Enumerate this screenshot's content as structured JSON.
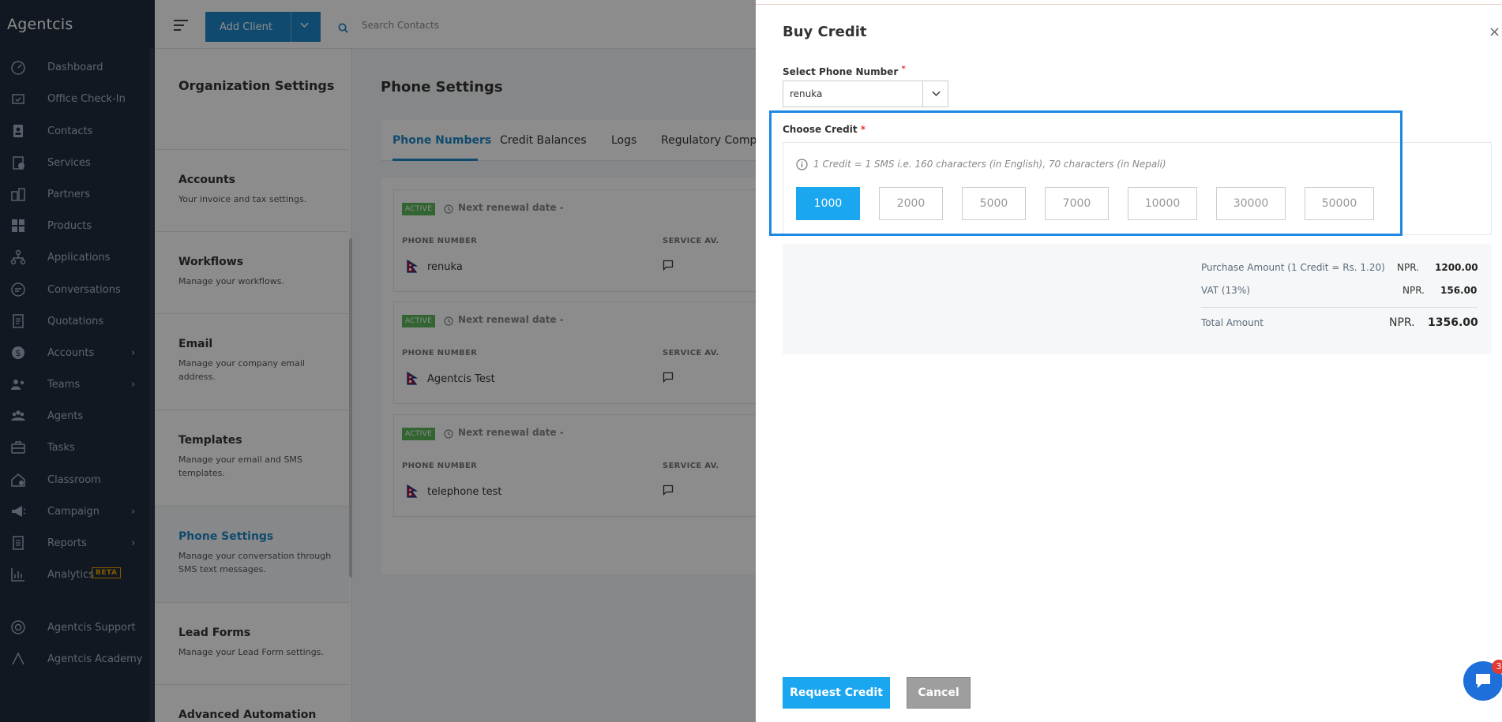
{
  "app": {
    "brand": "Agentcis",
    "nav": [
      {
        "label": "Dashboard",
        "icon": "dashboard-icon"
      },
      {
        "label": "Office Check-In",
        "icon": "check-in-icon"
      },
      {
        "label": "Contacts",
        "icon": "contacts-icon"
      },
      {
        "label": "Services",
        "icon": "services-icon"
      },
      {
        "label": "Partners",
        "icon": "partners-icon"
      },
      {
        "label": "Products",
        "icon": "products-icon"
      },
      {
        "label": "Applications",
        "icon": "applications-icon"
      },
      {
        "label": "Conversations",
        "icon": "conversations-icon"
      },
      {
        "label": "Quotations",
        "icon": "quotations-icon"
      },
      {
        "label": "Accounts",
        "icon": "accounts-icon",
        "chevron": "›"
      },
      {
        "label": "Teams",
        "icon": "teams-icon",
        "chevron": "›"
      },
      {
        "label": "Agents",
        "icon": "agents-icon"
      },
      {
        "label": "Tasks",
        "icon": "tasks-icon"
      },
      {
        "label": "Classroom",
        "icon": "classroom-icon"
      },
      {
        "label": "Campaign",
        "icon": "campaign-icon",
        "chevron": "›"
      },
      {
        "label": "Reports",
        "icon": "reports-icon",
        "chevron": "›"
      },
      {
        "label": "Analytics",
        "icon": "analytics-icon",
        "badge": "BETA"
      },
      {
        "label": "Agentcis Support",
        "icon": "support-icon"
      },
      {
        "label": "Agentcis Academy",
        "icon": "academy-icon"
      }
    ]
  },
  "topbar": {
    "add_client": "Add Client",
    "search_placeholder": "Search Contacts"
  },
  "settings": {
    "title": "Organization Settings",
    "items": [
      {
        "title": "Accounts",
        "desc": "Your invoice and tax settings."
      },
      {
        "title": "Workflows",
        "desc": "Manage your workflows."
      },
      {
        "title": "Email",
        "desc": "Manage your company email address."
      },
      {
        "title": "Templates",
        "desc": "Manage your email and SMS templates."
      },
      {
        "title": "Phone Settings",
        "desc": "Manage your conversation through SMS text messages."
      },
      {
        "title": "Lead Forms",
        "desc": "Manage your Lead Form settings."
      },
      {
        "title": "Advanced Automation",
        "desc": ""
      }
    ]
  },
  "phone": {
    "title": "Phone Settings",
    "tabs": [
      "Phone Numbers",
      "Credit Balances",
      "Logs",
      "Regulatory Compli"
    ],
    "labels": {
      "active": "ACTIVE",
      "renewal": "Next renewal date -",
      "phone_number": "PHONE NUMBER",
      "service": "SERVICE AV."
    },
    "numbers": [
      {
        "name": "renuka"
      },
      {
        "name": "Agentcis Test"
      },
      {
        "name": "telephone test"
      }
    ]
  },
  "drawer": {
    "title": "Buy Credit",
    "close": "×",
    "select_label": "Select Phone Number",
    "select_value": "renuka",
    "choose_label": "Choose Credit",
    "required": "*",
    "info": "1 Credit = 1 SMS i.e. 160 characters (in English), 70 characters (in Nepali)",
    "options": [
      "1000",
      "2000",
      "5000",
      "7000",
      "10000",
      "30000",
      "50000"
    ],
    "selected_option": "1000",
    "summary": {
      "purchase_label": "Purchase Amount",
      "purchase_note": "(1 Credit = Rs. 1.20)",
      "purchase_currency": "NPR.",
      "purchase_value": "1200.00",
      "vat_label": "VAT (13%)",
      "vat_currency": "NPR.",
      "vat_value": "156.00",
      "total_label": "Total Amount",
      "total_currency": "NPR.",
      "total_value": "1356.00"
    },
    "request_button": "Request Credit",
    "cancel_button": "Cancel",
    "notif_count": "3"
  }
}
